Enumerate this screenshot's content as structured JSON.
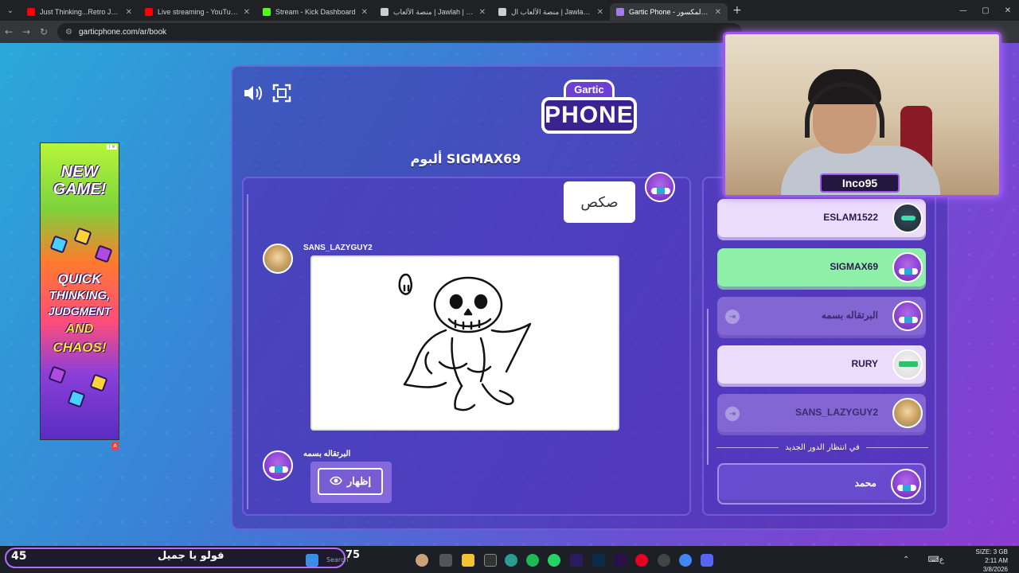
{
  "browser": {
    "tabs": [
      {
        "title": "Just Thinking...Retro Jazz - YouT",
        "color": "#ff0000"
      },
      {
        "title": "Live streaming - YouTube Studi",
        "color": "#ff0000"
      },
      {
        "title": "Stream - Kick Dashboard",
        "color": "#53fc18"
      },
      {
        "title": "منصة الألعاب | Jawlah | جولة",
        "color": "#cccccc"
      },
      {
        "title": "منصة الألعاب ال | Jawlah | جولة",
        "color": "#cccccc"
      },
      {
        "title": "Gartic Phone - الهاتف المكسور",
        "color": "#a07cf0"
      }
    ],
    "new_tab": "+",
    "url": "garticphone.com/ar/book"
  },
  "game": {
    "logo_top": "Gartic",
    "logo_bottom": "PHONE",
    "album_title": "ألبوم SIGMAX69",
    "speech_text": "صكص",
    "drawing_author": "SANS_LAZYGUY2",
    "next_author": "البرتقاله بسمه",
    "reveal_label": "إظهار",
    "players": [
      {
        "name": "ESLAM1522",
        "state": "normal"
      },
      {
        "name": "SIGMAX69",
        "state": "highlight"
      },
      {
        "name": "البرتقاله بسمه",
        "state": "dim"
      },
      {
        "name": "RURY",
        "state": "normal"
      },
      {
        "name": "SANS_LAZYGUY2",
        "state": "dim"
      }
    ],
    "waiting_label": "في انتظار الدور الجديد",
    "waiting_player": "محمد"
  },
  "ad": {
    "lines": [
      "NEW",
      "GAME!",
      "QUICK",
      "THINKING,",
      "JUDGMENT",
      "AND",
      "CHAOS!"
    ],
    "badge": "i ×"
  },
  "webcam": {
    "streamer_name": "Inco95"
  },
  "taskbar": {
    "follow_count": "45",
    "follow_text": "فولو يا جميل",
    "search": "Search",
    "counter": "75",
    "disk": "SIZE: 3 GB",
    "time": "2:11 AM",
    "date": "3/8/2026",
    "lang": "ع"
  }
}
